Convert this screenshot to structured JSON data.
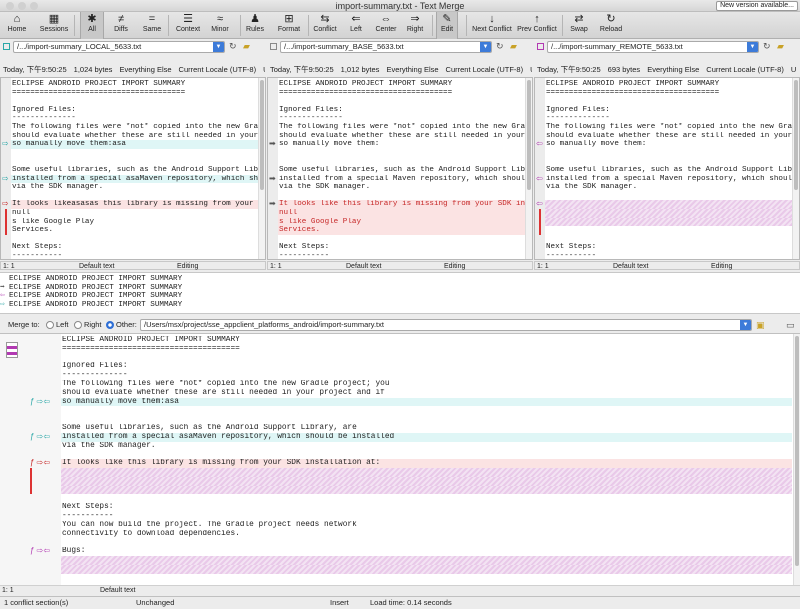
{
  "window": {
    "title": "import-summary.txt - Text Merge",
    "version_badge": "New version available..."
  },
  "toolbar": {
    "items": [
      {
        "label": "Home",
        "icon": "⌂"
      },
      {
        "label": "Sessions",
        "icon": "▦"
      },
      {
        "label": "All",
        "icon": "✱"
      },
      {
        "label": "Diffs",
        "icon": "≠"
      },
      {
        "label": "Same",
        "icon": "="
      },
      {
        "label": "Context",
        "icon": "☰"
      },
      {
        "label": "Minor",
        "icon": "≈"
      },
      {
        "label": "Rules",
        "icon": "♟"
      },
      {
        "label": "Format",
        "icon": "⊞"
      },
      {
        "label": "Conflict",
        "icon": "⇆"
      },
      {
        "label": "Left",
        "icon": "⇐"
      },
      {
        "label": "Center",
        "icon": "⇔"
      },
      {
        "label": "Right",
        "icon": "⇒"
      },
      {
        "label": "Edit",
        "icon": "✎"
      },
      {
        "label": "Next Conflict",
        "icon": "↓"
      },
      {
        "label": "Prev Conflict",
        "icon": "↑"
      },
      {
        "label": "Swap",
        "icon": "⇄"
      },
      {
        "label": "Reload",
        "icon": "↻"
      }
    ]
  },
  "panes": [
    {
      "path": "/.../import-summary_LOCAL_5633.txt",
      "color": "#2aa7a7",
      "info": [
        "Today, 下午9:50:25",
        "1,024 bytes",
        "Everything Else",
        "Current Locale (UTF-8)",
        "U"
      ],
      "status": {
        "pos": "1: 1",
        "mode": "Default text",
        "state": "Editing"
      },
      "lines": [
        {
          "t": "ECLIPSE ANDROID PROJECT IMPORT SUMMARY",
          "c": ""
        },
        {
          "t": "======================================",
          "c": ""
        },
        {
          "t": "",
          "c": ""
        },
        {
          "t": "Ignored Files:",
          "c": ""
        },
        {
          "t": "--------------",
          "c": ""
        },
        {
          "t": "The following files were *not* copied into the new Gradle",
          "c": ""
        },
        {
          "t": "should evaluate whether these are still needed in your pr",
          "c": ""
        },
        {
          "t": "so manually move them:asa",
          "c": "cyan"
        },
        {
          "t": "",
          "c": ""
        },
        {
          "t": "",
          "c": ""
        },
        {
          "t": "Some useful libraries, such as the Android Support Library",
          "c": ""
        },
        {
          "t": "installed from a special asaMaven repository, which shoul",
          "c": "cyan"
        },
        {
          "t": "via the SDK manager.",
          "c": ""
        },
        {
          "t": "",
          "c": ""
        },
        {
          "t": "It looks likeasasas this library is missing from your SDK",
          "c": "redbg"
        },
        {
          "t": "null",
          "c": ""
        },
        {
          "t": "s like Google Play",
          "c": ""
        },
        {
          "t": "Services.",
          "c": ""
        },
        {
          "t": "",
          "c": ""
        },
        {
          "t": "Next Steps:",
          "c": ""
        },
        {
          "t": "-----------",
          "c": ""
        },
        {
          "t": "You can now build the project. The Gradle project needs n",
          "c": ""
        }
      ]
    },
    {
      "path": "/.../import-summary_BASE_5633.txt",
      "color": "#888888",
      "info": [
        "Today, 下午9:50:25",
        "1,012 bytes",
        "Everything Else",
        "Current Locale (UTF-8)",
        "U"
      ],
      "status": {
        "pos": "1: 1",
        "mode": "Default text",
        "state": "Editing"
      },
      "lines": [
        {
          "t": "ECLIPSE ANDROID PROJECT IMPORT SUMMARY",
          "c": ""
        },
        {
          "t": "======================================",
          "c": ""
        },
        {
          "t": "",
          "c": ""
        },
        {
          "t": "Ignored Files:",
          "c": ""
        },
        {
          "t": "--------------",
          "c": ""
        },
        {
          "t": "The following files were *not* copied into the new Gradle",
          "c": ""
        },
        {
          "t": "should evaluate whether these are still needed in your p",
          "c": ""
        },
        {
          "t": "so manually move them:",
          "c": ""
        },
        {
          "t": "",
          "c": ""
        },
        {
          "t": "",
          "c": ""
        },
        {
          "t": "Some useful libraries, such as the Android Support Libra",
          "c": ""
        },
        {
          "t": "installed from a special Maven repository, which should",
          "c": ""
        },
        {
          "t": "via the SDK manager.",
          "c": ""
        },
        {
          "t": "",
          "c": ""
        },
        {
          "t": "It looks like this library is missing from your SDK inst",
          "c": "red"
        },
        {
          "t": "null",
          "c": "red"
        },
        {
          "t": "s like Google Play",
          "c": "red"
        },
        {
          "t": "Services.",
          "c": "red"
        },
        {
          "t": "",
          "c": ""
        },
        {
          "t": "Next Steps:",
          "c": ""
        },
        {
          "t": "-----------",
          "c": ""
        },
        {
          "t": "You can now build the project. The Gradle project needs",
          "c": ""
        }
      ]
    },
    {
      "path": "/.../import-summary_REMOTE_5633.txt",
      "color": "#b23ab2",
      "info": [
        "Today, 下午9:50:25",
        "693 bytes",
        "Everything Else",
        "Current Locale (UTF-8)",
        "U"
      ],
      "status": {
        "pos": "1: 1",
        "mode": "Default text",
        "state": "Editing"
      },
      "lines": [
        {
          "t": "ECLIPSE ANDROID PROJECT IMPORT SUMMARY",
          "c": ""
        },
        {
          "t": "======================================",
          "c": ""
        },
        {
          "t": "",
          "c": ""
        },
        {
          "t": "Ignored Files:",
          "c": ""
        },
        {
          "t": "--------------",
          "c": ""
        },
        {
          "t": "The following files were *not* copied into the new Gradle",
          "c": ""
        },
        {
          "t": "should evaluate whether these are still needed in your p",
          "c": ""
        },
        {
          "t": "so manually move them:",
          "c": ""
        },
        {
          "t": "",
          "c": ""
        },
        {
          "t": "",
          "c": ""
        },
        {
          "t": "Some useful libraries, such as the Android Support Libra",
          "c": ""
        },
        {
          "t": "installed from a special Maven repository, which should",
          "c": ""
        },
        {
          "t": "via the SDK manager.",
          "c": ""
        },
        {
          "t": "",
          "c": ""
        },
        {
          "t": "",
          "c": "magenta"
        },
        {
          "t": "",
          "c": "magenta"
        },
        {
          "t": "",
          "c": "magenta"
        },
        {
          "t": "",
          "c": ""
        },
        {
          "t": "",
          "c": ""
        },
        {
          "t": "Next Steps:",
          "c": ""
        },
        {
          "t": "-----------",
          "c": ""
        },
        {
          "t": "You can now build the project. The Gradle project needs",
          "c": ""
        }
      ]
    }
  ],
  "summary_lines": [
    "ECLIPSE ANDROID PROJECT IMPORT SUMMARY",
    "ECLIPSE ANDROID PROJECT IMPORT SUMMARY",
    "ECLIPSE ANDROID PROJECT IMPORT SUMMARY",
    "ECLIPSE ANDROID PROJECT IMPORT SUMMARY"
  ],
  "merge": {
    "label": "Merge to:",
    "left": "Left",
    "right": "Right",
    "other": "Other:",
    "path": "/Users/msx/project/sse_appclient_platforms_android/import-summary.txt"
  },
  "output": {
    "lines": [
      {
        "t": "ECLIPSE ANDROID PROJECT IMPORT SUMMARY",
        "c": ""
      },
      {
        "t": "======================================",
        "c": ""
      },
      {
        "t": "",
        "c": ""
      },
      {
        "t": "Ignored Files:",
        "c": ""
      },
      {
        "t": "--------------",
        "c": ""
      },
      {
        "t": "The following files were *not* copied into the new Gradle project; you",
        "c": ""
      },
      {
        "t": "should evaluate whether these are still needed in your project and if",
        "c": ""
      },
      {
        "t": "so manually move them:asa",
        "c": "cyan"
      },
      {
        "t": "",
        "c": ""
      },
      {
        "t": "",
        "c": ""
      },
      {
        "t": "Some useful libraries, such as the Android Support Library, are",
        "c": ""
      },
      {
        "t": "installed from a special asaMaven repository, which should be installed",
        "c": "cyan"
      },
      {
        "t": "via the SDK manager.",
        "c": ""
      },
      {
        "t": "",
        "c": ""
      },
      {
        "t": "It looks like this library is missing from your SDK installation at:",
        "c": "redbg"
      },
      {
        "t": "",
        "c": "magenta"
      },
      {
        "t": "",
        "c": "magenta"
      },
      {
        "t": "",
        "c": "magenta"
      },
      {
        "t": "",
        "c": ""
      },
      {
        "t": "Next Steps:",
        "c": ""
      },
      {
        "t": "-----------",
        "c": ""
      },
      {
        "t": "You can now build the project. The Gradle project needs network",
        "c": ""
      },
      {
        "t": "connectivity to download dependencies.",
        "c": ""
      },
      {
        "t": "",
        "c": ""
      },
      {
        "t": "Bugs:",
        "c": ""
      },
      {
        "t": "",
        "c": "magenta"
      },
      {
        "t": "",
        "c": "magenta"
      }
    ],
    "status": {
      "pos": "1: 1",
      "mode": "Default text"
    }
  },
  "statusbar": {
    "conflicts": "1 conflict section(s)",
    "state": "Unchanged",
    "mode": "Insert",
    "load": "Load time: 0.14 seconds"
  }
}
